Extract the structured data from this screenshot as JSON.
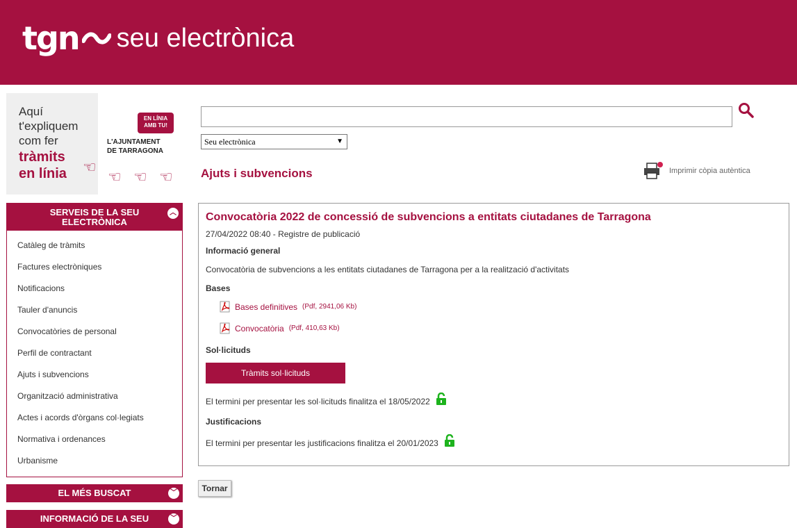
{
  "header": {
    "logo_mark": "tgn",
    "logo_text": "seu electrònica",
    "color": "#a51140"
  },
  "promo": {
    "lines": [
      "Aquí",
      "t'expliquem",
      "com fer"
    ],
    "bold_lines": [
      "tràmits",
      "en línia"
    ],
    "badge": "EN LÍNIA AMB TU!",
    "ajuntament": [
      "L'AJUNTAMENT",
      "DE TARRAGONA"
    ]
  },
  "sidebar": {
    "title": "SERVEIS DE LA SEU ELECTRÒNICA",
    "items": [
      "Catàleg de tràmits",
      "Factures electròniques",
      "Notificacions",
      "Tauler d'anuncis",
      "Convocatòries de personal",
      "Perfil de contractant",
      "Ajuts i subvencions",
      "Organització administrativa",
      "Actes i acords d'òrgans col·legiats",
      "Normativa i ordenances",
      "Urbanisme"
    ],
    "accordions": [
      "EL MÉS BUSCAT",
      "INFORMACIÓ DE LA SEU"
    ]
  },
  "search": {
    "value": "",
    "select_value": "Seu electrònica"
  },
  "page": {
    "title": "Ajuts i subvencions",
    "print_label": "Imprimir còpia autèntica"
  },
  "detail": {
    "title": "Convocatòria 2022 de concessió de subvencions a entitats ciutadanes de Tarragona",
    "date": "27/04/2022 08:40 - Registre de publicació",
    "info_heading": "Informació general",
    "info_text": "Convocatòria de subvencions a les entitats ciutadanes de Tarragona per a la realització d'activitats",
    "bases_heading": "Bases",
    "docs": [
      {
        "label": "Bases definitives",
        "meta": "(Pdf, 2941,06 Kb)"
      },
      {
        "label": "Convocatòria",
        "meta": "(Pdf, 410,63 Kb)"
      }
    ],
    "sollicituds_heading": "Sol·licituds",
    "button": "Tràmits sol·licituds",
    "sollicituds_deadline": "El termini per presentar les sol·licituds finalitza el 18/05/2022",
    "just_heading": "Justificacions",
    "just_deadline": "El termini per presentar les justificacions finalitza el 20/01/2023"
  },
  "back_button": "Tornar"
}
